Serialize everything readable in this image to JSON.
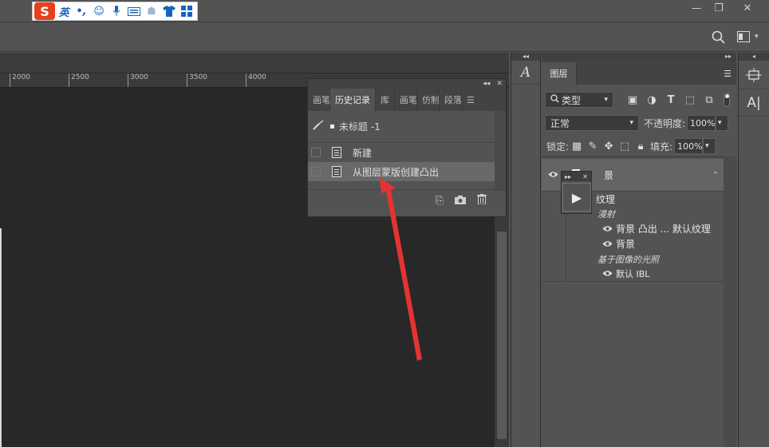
{
  "ime_toolbar": {
    "logo": "S",
    "mode": "英",
    "punct": "•,",
    "icons": [
      "smiley-icon",
      "microphone-icon",
      "keyboard-icon",
      "skin-icon",
      "shirt-icon",
      "grid-icon"
    ]
  },
  "ruler": {
    "ticks": [
      "2000",
      "2500",
      "3000",
      "3500",
      "4000"
    ]
  },
  "history_panel": {
    "tabs": [
      {
        "label": "画笔",
        "active": false
      },
      {
        "label": "历史记录",
        "active": true
      },
      {
        "label": "库",
        "active": false
      },
      {
        "label": "画笔",
        "active": false
      },
      {
        "label": "仿制",
        "active": false
      },
      {
        "label": "段落",
        "active": false
      }
    ],
    "snapshot_label": "未标题 -1",
    "items": [
      {
        "label": "新建",
        "selected": false
      },
      {
        "label": "从图层蒙版创建凸出",
        "selected": true
      }
    ]
  },
  "layers_panel": {
    "tab_label": "图层",
    "filter_value": "类型",
    "blend_mode": "正常",
    "opacity_label": "不透明度:",
    "opacity_value": "100%",
    "lock_label": "锁定:",
    "fill_label": "填充:",
    "fill_value": "100%",
    "layer_name": "景",
    "rows": {
      "texture": "纹理",
      "diffuse": "漫射",
      "bg_extrude": "背景 凸出 ... 默认纹理",
      "bg": "背景",
      "ibl": "基于图像的光照",
      "default_ibl": "默认 IBL"
    }
  },
  "colors": {
    "panel": "#535353",
    "doc_bg": "#282828",
    "arrow": "#e53333"
  }
}
